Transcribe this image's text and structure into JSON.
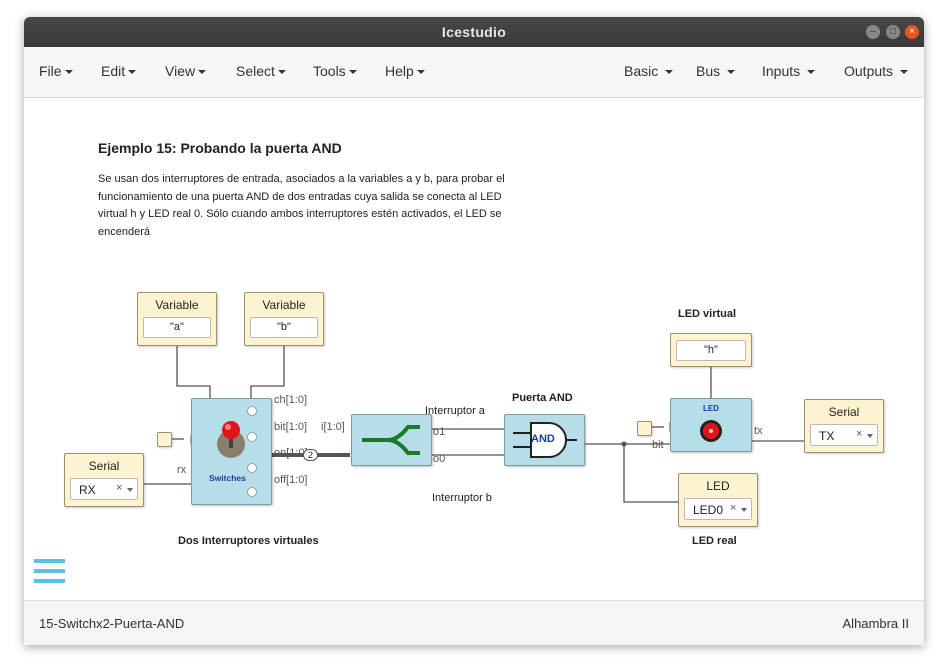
{
  "window": {
    "title": "Icestudio"
  },
  "menu_left": [
    "File",
    "Edit",
    "View",
    "Select",
    "Tools",
    "Help"
  ],
  "menu_right": [
    "Basic",
    "Bus",
    "Inputs",
    "Outputs"
  ],
  "content": {
    "heading": "Ejemplo 15: Probando la puerta AND",
    "description": "Se usan dos interruptores de entrada, asociados a la variables a y b, para probar el funcionamiento de una puerta AND de dos entradas cuya salida se conecta al LED virtual h y LED real 0. Sólo cuando ambos interruptores estén activados, el LED se encenderá"
  },
  "blocks": {
    "var_a": {
      "title": "Variable",
      "value": "\"a\""
    },
    "var_b": {
      "title": "Variable",
      "value": "\"b\""
    },
    "var_h": {
      "value": "\"h\""
    },
    "serial_rx": {
      "title": "Serial",
      "value": "RX",
      "clear": "×"
    },
    "serial_tx": {
      "title": "Serial",
      "value": "TX",
      "clear": "×"
    },
    "led_real": {
      "title": "LED",
      "value": "LED0",
      "clear": "×"
    },
    "switches": {
      "name": "Switches",
      "caption": "Dos Interruptores virtuales",
      "ports": [
        "ch[1:0]",
        "bit[1:0]",
        "on[1:0]",
        "off[1:0]"
      ],
      "input": "rx",
      "bus_width": "2"
    },
    "splitter": {
      "input": "i[1:0]",
      "outputs": [
        "o1",
        "o0"
      ]
    },
    "and_gate": {
      "label": "AND",
      "title": "Puerta AND",
      "input_a": "Interruptor a",
      "input_b": "Interruptor b"
    },
    "led_virtual": {
      "title": "LED virtual",
      "name": "LED",
      "input": "bit",
      "output": "tx",
      "caption": "LED real"
    }
  },
  "status": {
    "file": "15-Switchx2-Puerta-AND",
    "board": "Alhambra II"
  },
  "colors": {
    "block_module": "#b7dde8",
    "block_constant": "#fdf3d0",
    "accent_close": "#e95420",
    "led_red": "#e0141b",
    "splitter_green": "#1a7a2a"
  }
}
